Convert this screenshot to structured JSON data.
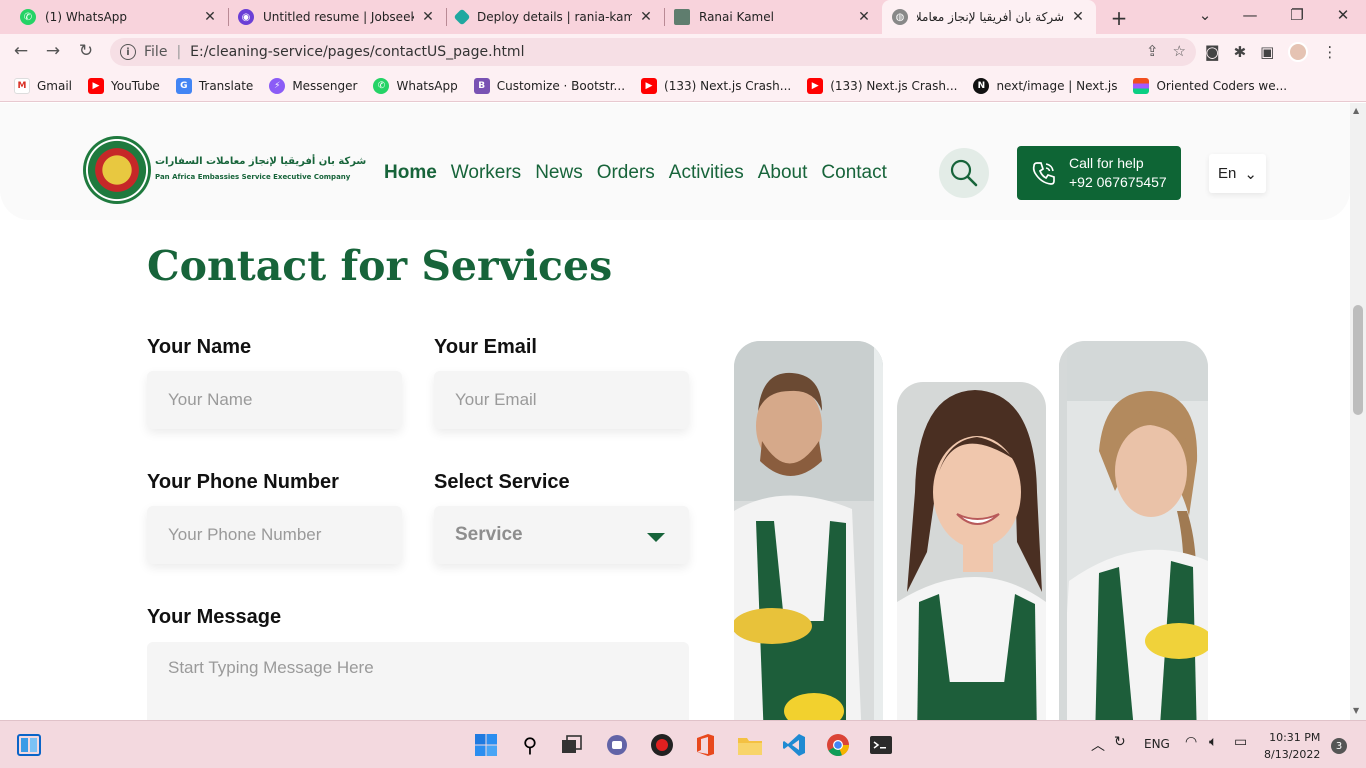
{
  "browser": {
    "tabs": [
      {
        "label": "(1) WhatsApp",
        "icon": "whatsapp-icon"
      },
      {
        "label": "Untitled resume | Jobseeker",
        "icon": "jobseeker-icon"
      },
      {
        "label": "Deploy details | rania-kamel-",
        "icon": "netlify-icon"
      },
      {
        "label": "Ranai Kamel",
        "icon": "page-icon"
      },
      {
        "label": "شركة بان أفريقيا لإنجاز معاملات",
        "icon": "globe-icon",
        "active": true
      }
    ],
    "address": {
      "scheme_label": "File",
      "url": "E:/cleaning-service/pages/contactUS_page.html"
    },
    "bookmarks": [
      {
        "label": "Gmail",
        "icon": "gmail-icon"
      },
      {
        "label": "YouTube",
        "icon": "youtube-icon"
      },
      {
        "label": "Translate",
        "icon": "translate-icon"
      },
      {
        "label": "Messenger",
        "icon": "messenger-icon"
      },
      {
        "label": "WhatsApp",
        "icon": "whatsapp-icon"
      },
      {
        "label": "Customize · Bootstr...",
        "icon": "bootstrap-icon"
      },
      {
        "label": "(133) Next.js Crash...",
        "icon": "youtube-icon"
      },
      {
        "label": "(133) Next.js Crash...",
        "icon": "youtube-icon"
      },
      {
        "label": "next/image | Next.js",
        "icon": "nextjs-icon"
      },
      {
        "label": "Oriented Coders we...",
        "icon": "figma-icon"
      }
    ]
  },
  "site": {
    "logo": {
      "arabic_name": "شركة بان أفريقيا لإنجاز معاملات السفارات",
      "english_name": "Pan Africa Embassies Service Executive Company"
    },
    "nav": [
      "Home",
      "Workers",
      "News",
      "Orders",
      "Activities",
      "About",
      "Contact"
    ],
    "call": {
      "line1": "Call for help",
      "line2": "+92 067675457"
    },
    "lang": "En",
    "colors": {
      "brand": "#17643a",
      "button": "#0e6535"
    }
  },
  "form": {
    "title": "Contact for Services",
    "name_label": "Your Name",
    "name_placeholder": "Your Name",
    "email_label": "Your Email",
    "email_placeholder": "Your Email",
    "phone_label": "Your Phone Number",
    "phone_placeholder": "Your Phone Number",
    "service_label": "Select Service",
    "service_value": "Service",
    "message_label": "Your Message",
    "message_placeholder": "Start Typing Message Here"
  },
  "taskbar": {
    "language": "ENG",
    "time": "10:31 PM",
    "date": "8/13/2022",
    "notifications": "3"
  }
}
